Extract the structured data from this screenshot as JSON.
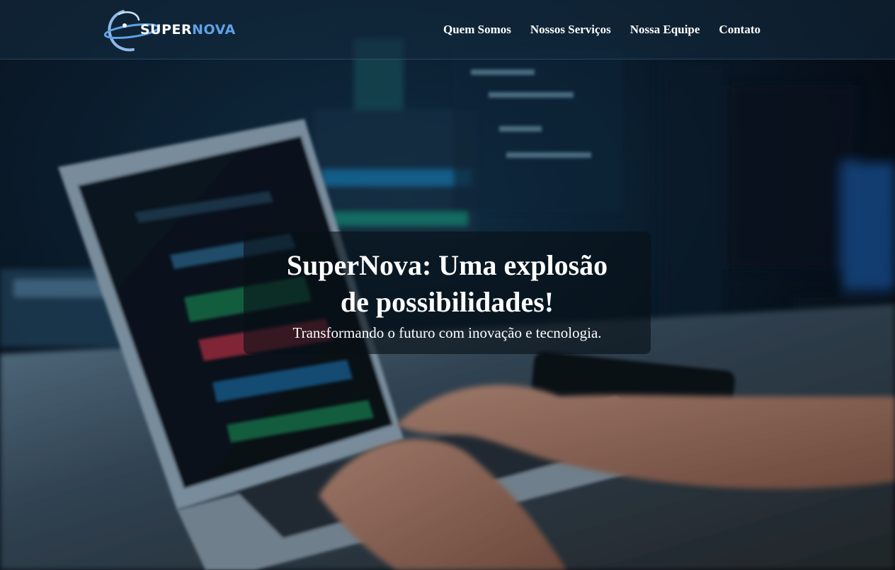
{
  "brand": {
    "name_part1": "SUPER",
    "name_part2": "NOVA",
    "accent_color": "#5ea2e6"
  },
  "nav": {
    "items": [
      {
        "label": "Quem Somos"
      },
      {
        "label": "Nossos Serviços"
      },
      {
        "label": "Nossa Equipe"
      },
      {
        "label": "Contato"
      }
    ]
  },
  "hero": {
    "title": "SuperNova: Uma explosão de possibilidades!",
    "subtitle": "Transformando o futuro com inovação e tecnologia."
  },
  "colors": {
    "header_bg": "#142c40",
    "text": "#ffffff",
    "background": "#050a14"
  }
}
